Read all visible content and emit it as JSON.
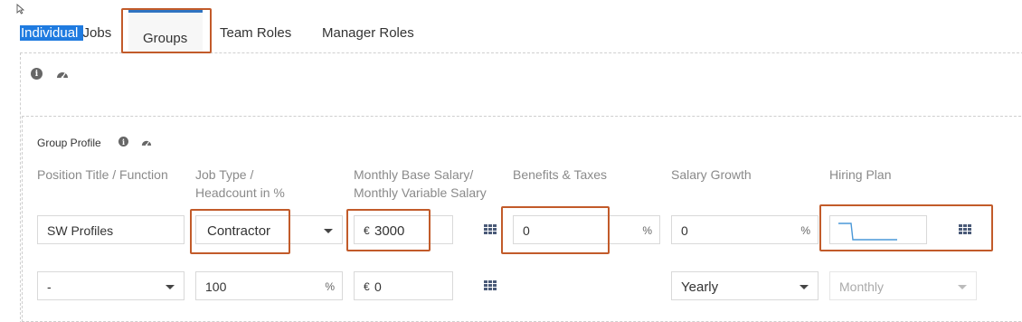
{
  "tabs": {
    "individual_highlight": "Individual ",
    "individual_rest": "Jobs",
    "groups": "Groups",
    "team_roles": "Team Roles",
    "manager_roles": "Manager Roles"
  },
  "group_profile": {
    "title": "Group Profile",
    "headers": {
      "position": "Position Title / Function",
      "job_type_1": "Job Type /",
      "job_type_2": "Headcount in %",
      "salary_1": "Monthly Base Salary/",
      "salary_2": "Monthly Variable Salary",
      "benefits": "Benefits & Taxes",
      "growth": "Salary Growth",
      "hiring": "Hiring Plan"
    },
    "row1": {
      "position": "SW Profiles",
      "job_type": "Contractor",
      "salary_currency": "€",
      "salary": "3000",
      "benefits": "0",
      "benefits_unit": "%",
      "growth": "0",
      "growth_unit": "%"
    },
    "row2": {
      "position": "-",
      "headcount": "100",
      "headcount_unit": "%",
      "variable_currency": "€",
      "variable": "0",
      "growth_period": "Yearly",
      "hiring_period": "Monthly"
    }
  },
  "colors": {
    "highlight": "#1f7be0",
    "tab_accent": "#2f73c1",
    "annotation": "#c25b2a",
    "icon": "#4a5a78"
  }
}
